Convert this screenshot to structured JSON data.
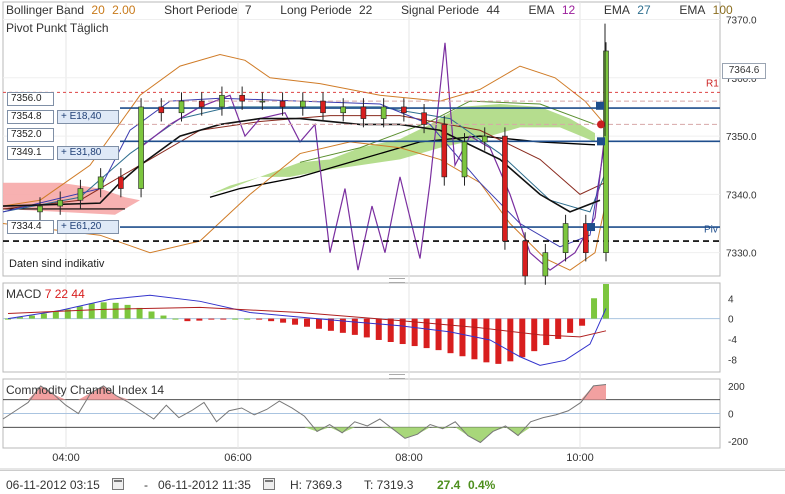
{
  "legend": {
    "bollinger_label": "Bollinger Band",
    "bollinger_p1": "20",
    "bollinger_p2": "2.00",
    "short_label": "Short Periode",
    "short_value": "7",
    "long_label": "Long Periode",
    "long_value": "22",
    "signal_label": "Signal Periode",
    "signal_value": "44",
    "ema_label": "EMA",
    "ema12": "12",
    "ema27": "27",
    "ema100": "100",
    "pivot": "Pivot Punkt Täglich"
  },
  "colors": {
    "bollinger_param": "#c87a1a",
    "ema12": "#9b1f9b",
    "ema27": "#2f6f8f",
    "ema100": "#8a6d1f",
    "cloud_green": "#a8d77a",
    "cloud_red": "#f6a8a8",
    "macd_pos": "#7cc63e",
    "macd_neg": "#d81e1e",
    "level_line": "#1f4e8c"
  },
  "price_tags": [
    {
      "price": "7356.0",
      "ema": ""
    },
    {
      "price": "7354.8",
      "ema": "+ E18,40"
    },
    {
      "price": "7352.0",
      "ema": ""
    },
    {
      "price": "7349.1",
      "ema": "+ E31,80"
    },
    {
      "price": "7334.4",
      "ema": "+ E61,20"
    }
  ],
  "last_price": "7364.6",
  "indicative_note": "Daten sind indikativ",
  "macd_label": {
    "name": "MACD",
    "p1": "7",
    "p2": "22",
    "p3": "44"
  },
  "cci_label": {
    "name": "Commodity Channel Index",
    "p": "14"
  },
  "footer": {
    "start": "06-11-2012 03:15",
    "dash": "-",
    "end": "06-11-2012 11:35",
    "high": "H: 7369.3",
    "low": "T: 7319.3",
    "change": "27.4",
    "change_pct": "0.4%"
  },
  "chart_data": [
    {
      "type": "candlestick",
      "title": "",
      "x": [
        "03:15",
        "03:30",
        "03:45",
        "04:00",
        "04:15",
        "04:30",
        "04:45",
        "05:00",
        "05:15",
        "05:30",
        "05:45",
        "06:00",
        "06:15",
        "06:30",
        "06:45",
        "07:00",
        "07:15",
        "07:30",
        "07:45",
        "08:00",
        "08:15",
        "08:30",
        "08:45",
        "09:00",
        "09:15",
        "09:30",
        "09:45",
        "10:00",
        "10:15"
      ],
      "x_tick_labels": [
        "04:00",
        "06:00",
        "08:00",
        "10:00"
      ],
      "y_tick_labels": [
        "7370.0",
        "7360.0",
        "7350.0",
        "7340.0",
        "7330.0"
      ],
      "ylim": [
        7326,
        7373
      ],
      "close": [
        7338,
        7339,
        7341,
        7343,
        7341,
        7355,
        7354,
        7356,
        7355,
        7357,
        7356,
        7356,
        7355,
        7356,
        7354,
        7355,
        7353,
        7355,
        7354,
        7352,
        7343,
        7349,
        7350,
        7332,
        7326,
        7330,
        7335,
        7330,
        7364.6
      ],
      "levels": {
        "R1": 7357.5,
        "Piv": 7334.4
      },
      "level_labels": [
        "R1",
        "Piv"
      ],
      "horizontal_levels": [
        7356.0,
        7354.8,
        7352.0,
        7349.1,
        7334.4
      ]
    },
    {
      "type": "bar",
      "title": "MACD 7 22 44",
      "y_tick_labels": [
        "4",
        "0",
        "-4",
        "-8"
      ],
      "ylim": [
        -10.5,
        7
      ],
      "values": [
        0,
        0.3,
        0.6,
        1,
        1.4,
        1.8,
        2.4,
        3,
        3.2,
        3.1,
        2.7,
        2.1,
        1.4,
        0.6,
        0,
        -0.5,
        -0.4,
        -0.2,
        -0.1,
        0,
        0,
        -0.2,
        -0.5,
        -0.8,
        -1.2,
        -1.6,
        -2,
        -2.4,
        -2.8,
        -3.2,
        -3.7,
        -4.2,
        -4.6,
        -5,
        -5.4,
        -5.8,
        -6.2,
        -6.8,
        -7.4,
        -8,
        -8.6,
        -8.9,
        -8.4,
        -7.6,
        -6.4,
        -5.2,
        -4,
        -2.8,
        -1.4,
        4,
        6.8
      ]
    },
    {
      "type": "line",
      "title": "Commodity Channel Index 14",
      "y_tick_labels": [
        "200",
        "0",
        "-200"
      ],
      "ylim": [
        -250,
        250
      ],
      "values": [
        -40,
        20,
        80,
        200,
        140,
        60,
        0,
        150,
        200,
        130,
        80,
        20,
        -40,
        60,
        -30,
        20,
        80,
        -60,
        20,
        40,
        -10,
        30,
        90,
        40,
        -20,
        -130,
        -80,
        -140,
        -60,
        -90,
        -40,
        -110,
        -180,
        -150,
        -80,
        -110,
        -60,
        -160,
        -210,
        -130,
        -90,
        -160,
        -60,
        -30,
        -10,
        20,
        80,
        200,
        210
      ]
    }
  ]
}
